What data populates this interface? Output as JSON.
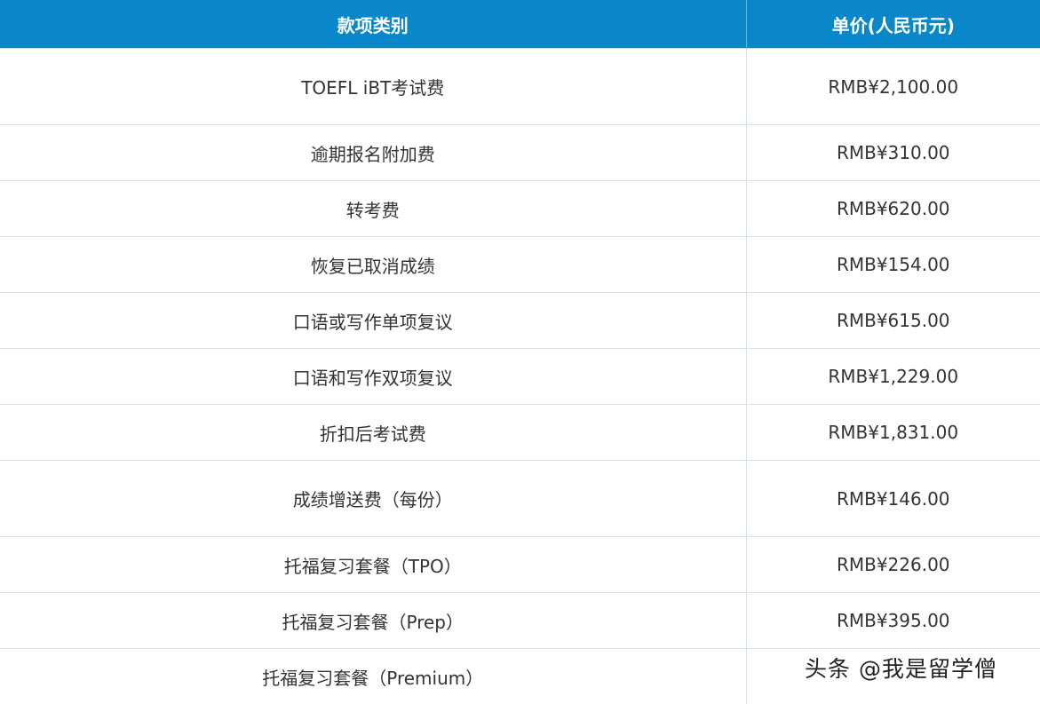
{
  "table": {
    "headers": {
      "item": "款项类别",
      "price": "单价(人民币元)"
    },
    "rows": [
      {
        "item": "TOEFL iBT考试费",
        "price": "RMB¥2,100.00"
      },
      {
        "item": "逾期报名附加费",
        "price": "RMB¥310.00"
      },
      {
        "item": "转考费",
        "price": "RMB¥620.00"
      },
      {
        "item": "恢复已取消成绩",
        "price": "RMB¥154.00"
      },
      {
        "item": "口语或写作单项复议",
        "price": "RMB¥615.00"
      },
      {
        "item": "口语和写作双项复议",
        "price": "RMB¥1,229.00"
      },
      {
        "item": "折扣后考试费",
        "price": "RMB¥1,831.00"
      },
      {
        "item": "成绩增送费（每份）",
        "price": "RMB¥146.00"
      },
      {
        "item": "托福复习套餐（TPO）",
        "price": "RMB¥226.00"
      },
      {
        "item": "托福复习套餐（Prep）",
        "price": "RMB¥395.00"
      },
      {
        "item": "托福复习套餐（Premium）",
        "price": ""
      }
    ]
  },
  "watermark": "头条 @我是留学僧",
  "colors": {
    "header_bg": "#0a87c9",
    "price_text": "#e0531f",
    "body_text": "#333333"
  }
}
